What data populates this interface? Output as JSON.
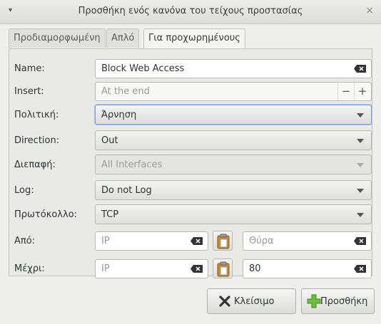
{
  "window": {
    "title": "Προσθήκη ενός κανόνα του τείχους προστασίας",
    "menu_icon": "▾",
    "close_icon": "×"
  },
  "tabs": [
    {
      "label": "Προδιαμορφωμένη",
      "active": false
    },
    {
      "label": "Απλό",
      "active": false
    },
    {
      "label": "Για προχωρημένους",
      "active": true
    }
  ],
  "form": {
    "name": {
      "label": "Name:",
      "value": "Block Web Access"
    },
    "insert": {
      "label": "Insert:",
      "placeholder": "At the end",
      "minus": "−",
      "plus": "+"
    },
    "policy": {
      "label": "Πολιτική:",
      "value": "Άρνηση"
    },
    "direction": {
      "label": "Direction:",
      "value": "Out"
    },
    "interface": {
      "label": "Διεπαφή:",
      "value": "All Interfaces"
    },
    "log": {
      "label": "Log:",
      "value": "Do not Log"
    },
    "protocol": {
      "label": "Πρωτόκολλο:",
      "value": "TCP"
    },
    "from": {
      "label": "Από:",
      "ip_placeholder": "IP",
      "port_placeholder": "Θύρα",
      "port_value": ""
    },
    "to": {
      "label": "Μέχρι:",
      "ip_placeholder": "IP",
      "port_value": "80"
    }
  },
  "buttons": {
    "close_label": "Κλείσιμο",
    "add_label": "Προσθήκη"
  },
  "colors": {
    "focus": "#7aa0d4",
    "add_icon": "#6cbf3c",
    "close_icon": "#3a3a3a"
  }
}
